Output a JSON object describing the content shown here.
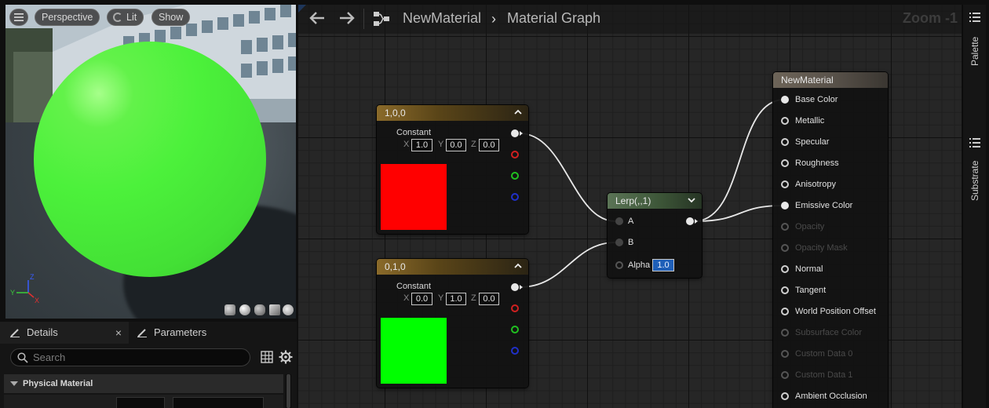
{
  "viewport": {
    "menu_icon": "hamburger-icon",
    "perspective_label": "Perspective",
    "lit_label": "Lit",
    "show_label": "Show",
    "axis_x": "X",
    "axis_y": "Y",
    "axis_z": "Z"
  },
  "details_panel": {
    "tabs": [
      {
        "label": "Details",
        "icon": "pencil-icon",
        "closable": true
      },
      {
        "label": "Parameters",
        "icon": "pencil-icon",
        "closable": false
      }
    ],
    "close_glyph": "×",
    "search": {
      "placeholder": "Search",
      "value": ""
    },
    "section_title": "Physical Material"
  },
  "graph": {
    "breadcrumb": [
      "NewMaterial",
      "Material Graph"
    ],
    "breadcrumb_separator": "›",
    "zoom_label": "Zoom -1",
    "nodes": {
      "constant_red": {
        "title": "1,0,0",
        "label": "Constant",
        "x_label": "X",
        "x": "1.0",
        "y_label": "Y",
        "y": "0.0",
        "z_label": "Z",
        "z": "0.0",
        "swatch_color": "#ff0000"
      },
      "constant_green": {
        "title": "0,1,0",
        "label": "Constant",
        "x_label": "X",
        "x": "0.0",
        "y_label": "Y",
        "y": "1.0",
        "z_label": "Z",
        "z": "0.0",
        "swatch_color": "#00ff00"
      },
      "lerp": {
        "title": "Lerp(,,1)",
        "inputs": [
          "A",
          "B",
          "Alpha"
        ],
        "alpha_value": "1.0"
      },
      "material": {
        "title": "NewMaterial",
        "inputs": [
          {
            "label": "Base Color",
            "enabled": true,
            "connected": true
          },
          {
            "label": "Metallic",
            "enabled": true,
            "connected": false
          },
          {
            "label": "Specular",
            "enabled": true,
            "connected": false
          },
          {
            "label": "Roughness",
            "enabled": true,
            "connected": false
          },
          {
            "label": "Anisotropy",
            "enabled": true,
            "connected": false
          },
          {
            "label": "Emissive Color",
            "enabled": true,
            "connected": true
          },
          {
            "label": "Opacity",
            "enabled": false,
            "connected": false
          },
          {
            "label": "Opacity Mask",
            "enabled": false,
            "connected": false
          },
          {
            "label": "Normal",
            "enabled": true,
            "connected": false
          },
          {
            "label": "Tangent",
            "enabled": true,
            "connected": false
          },
          {
            "label": "World Position Offset",
            "enabled": true,
            "connected": false
          },
          {
            "label": "Subsurface Color",
            "enabled": false,
            "connected": false
          },
          {
            "label": "Custom Data 0",
            "enabled": false,
            "connected": false
          },
          {
            "label": "Custom Data 1",
            "enabled": false,
            "connected": false
          },
          {
            "label": "Ambient Occlusion",
            "enabled": true,
            "connected": false
          }
        ]
      }
    }
  },
  "side_tabs": [
    {
      "label": "Palette",
      "icon": "list-icon"
    },
    {
      "label": "Substrate",
      "icon": "list-icon"
    }
  ],
  "colors": {
    "sphere": "#4cf13b",
    "accent": "#2e74d9",
    "wire": "#e8e8e8"
  }
}
